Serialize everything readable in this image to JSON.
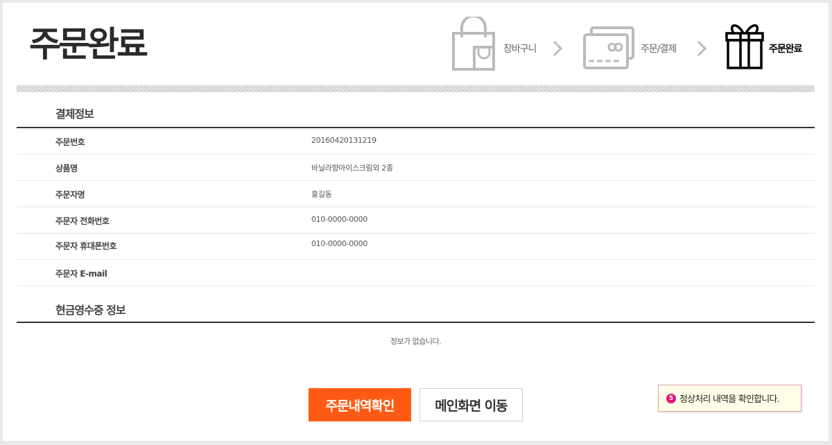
{
  "page": {
    "title": "주문완료"
  },
  "steps": [
    {
      "label": "장바구니",
      "icon": "shopping-bag-icon",
      "current": false
    },
    {
      "label": "주문/결제",
      "icon": "credit-card-icon",
      "current": false
    },
    {
      "label": "주문완료",
      "icon": "gift-box-icon",
      "current": true
    }
  ],
  "payment_info": {
    "title": "결제정보",
    "rows": [
      {
        "label": "주문번호",
        "value": "20160420131219"
      },
      {
        "label": "상품명",
        "value": "바닐라향아이스크림외 2종"
      },
      {
        "label": "주문자명",
        "value": "홍길동"
      },
      {
        "label": "주문자 전화번호",
        "value": "010-0000-0000"
      },
      {
        "label": "주문자 휴대폰번호",
        "value": "010-0000-0000"
      },
      {
        "label": "주문자 E-mail",
        "value": ""
      }
    ]
  },
  "cash_receipt": {
    "title": "현금영수증 정보",
    "empty_message": "정보가 없습니다."
  },
  "buttons": {
    "order_history": "주문내역확인",
    "go_main": "메인화면 이동"
  },
  "tooltip": {
    "number": "5",
    "text": "정상처리 내역을 확인합니다."
  },
  "colors": {
    "accent": "#ff5a14",
    "step_inactive": "#bbbbbb",
    "step_active": "#000000",
    "tooltip_badge": "#e0147a"
  }
}
